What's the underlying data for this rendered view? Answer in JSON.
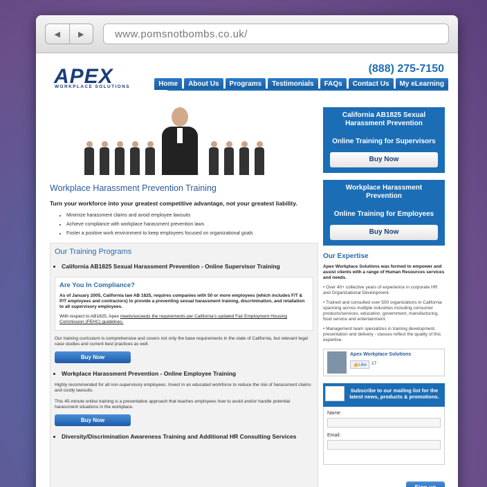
{
  "browser": {
    "url": "www.pomsnotbombs.co.uk/",
    "back_icon": "back-arrow",
    "forward_icon": "forward-arrow"
  },
  "header": {
    "logo_text": "APEX",
    "logo_tagline": "WORKPLACE SOLUTIONS",
    "phone": "(888) 275-7150",
    "nav": [
      "Home",
      "About Us",
      "Programs",
      "Testimonials",
      "FAQs",
      "Contact Us",
      "My eLearning"
    ]
  },
  "main": {
    "title": "Workplace Harassment Prevention Training",
    "intro": "Turn your workforce into your greatest competitive advantage, not your greatest liability.",
    "bullets": [
      "Minimize harassment claims and avoid employee lawsuits",
      "Achieve compliance with workplace harassment prevention laws",
      "Foster a positive work environment to keep employees focused on organizational goals"
    ],
    "programs_heading": "Our Training Programs",
    "program1": "California AB1825 Sexual Harassment Prevention - Online Supervisor Training",
    "compliance_title": "Are You In Compliance?",
    "compliance_bold": "As of January 2005, California law AB 1825, requires companies with 50 or more employees (which includes F/T & P/T employees and contractors) to provide a preventing sexual harassment training, discrimination, and retaliation to all supervisory employees.",
    "compliance_prefix": "With respect to AB1825, Apex ",
    "compliance_link": "meets/exceeds the requirements per California's updated Fair Employment Housing Commission (FEHC) guidelines.",
    "program1_text": "Our training curriculum is comprehensive and covers not only the base requirements in the state of California, but relevant legal case studies and current best practices as well.",
    "buy_label": "Buy Now",
    "program2": "Workplace Harassment Prevention - Online Employee Training",
    "program2_text1": "Highly recommended for all non-supervisory employees. Invest in an educated workforce to reduce the risk of harassment claims and costly lawsuits.",
    "program2_text2": "This 45-minute online training is a preventative approach that teaches employees how to avoid and/or handle potential harassment situations in the workplace.",
    "program3": "Diversity/Discrimination Awareness Training and Additional HR Consulting Services"
  },
  "sidebar": {
    "box1_title": "California AB1825 Sexual Harassment Prevention",
    "box1_sub": "Online Training for Supervisors",
    "box2_title": "Workplace Harassment Prevention",
    "box2_sub": "Online Training for Employees",
    "buy_label": "Buy Now",
    "expertise_heading": "Our Expertise",
    "expertise_intro": "Apex Workplace Solutions was formed to empower and assist clients with a range of Human Resources services and needs.",
    "expertise_points": [
      "• Over 40+ collective years of experience in corporate HR and Organizational Development.",
      "• Trained and consulted over 500 organizations in California spanning across multiple industries including consumer products/services, education, government, manufacturing, food service and entertainment.",
      "• Management team specializes in training development, presentation and delivery - classes reflect the quality of this expertise."
    ],
    "fb_name": "Apex Workplace Solutions",
    "fb_like": "Like",
    "fb_count": "17",
    "mail_text": "Subscribe to our mailing list for the latest news, products & promotions.",
    "name_label": "Name:",
    "email_label": "Email:",
    "signup_label": "Sign up"
  }
}
